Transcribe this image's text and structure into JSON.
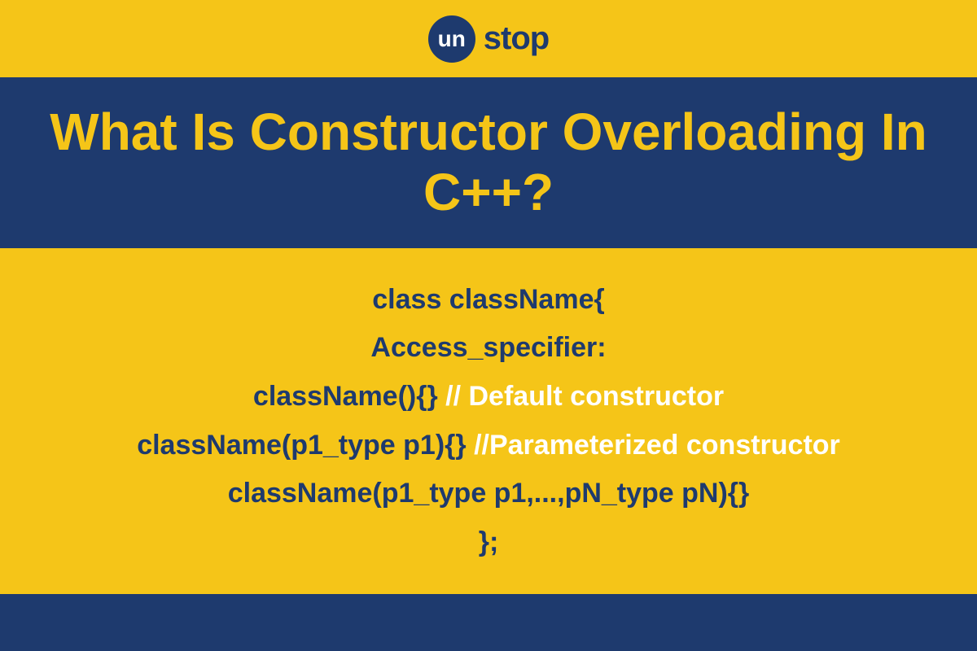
{
  "logo": {
    "circle_text": "un",
    "suffix_text": "stop"
  },
  "title": "What Is Constructor Overloading In C++?",
  "code": {
    "line1": "class className{",
    "line2": "Access_specifier:",
    "line3_code": "className(){} ",
    "line3_comment": "// Default constructor",
    "line4_code": "className(p1_type p1){} ",
    "line4_comment": "//Parameterized constructor",
    "line5": "className(p1_type p1,...,pN_type pN){}",
    "line6": "};"
  },
  "colors": {
    "background": "#F5C518",
    "band": "#1E3A6E",
    "comment": "#FFFFFF"
  }
}
